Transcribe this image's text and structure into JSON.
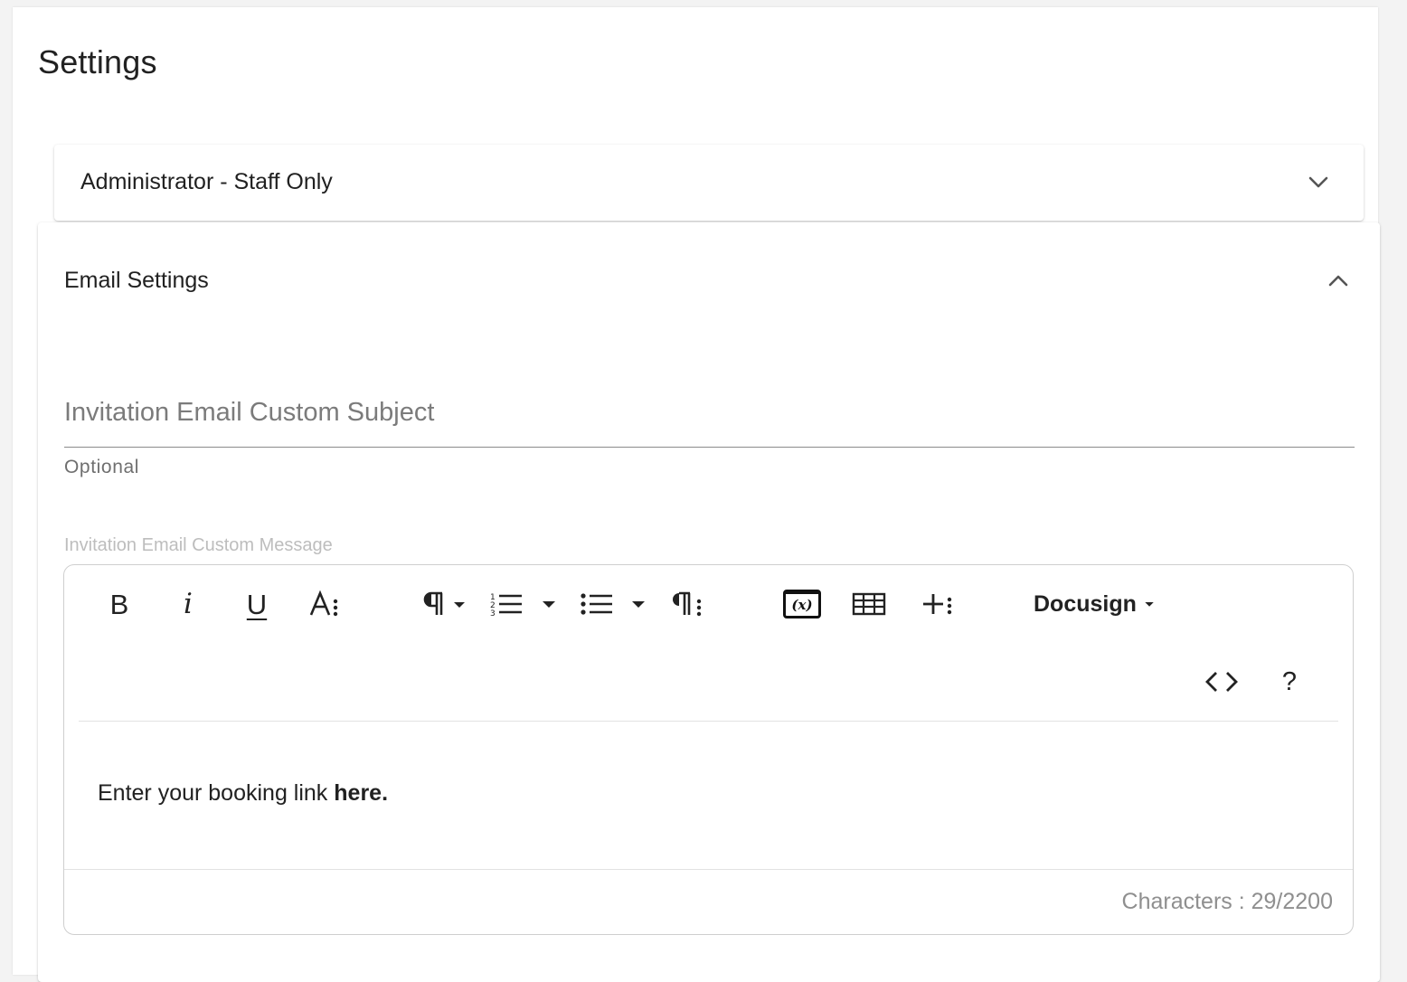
{
  "page": {
    "title": "Settings"
  },
  "panels": {
    "admin": {
      "title": "Administrator - Staff Only",
      "state": "collapsed"
    },
    "email": {
      "title": "Email Settings",
      "state": "expanded"
    }
  },
  "email_form": {
    "subject": {
      "placeholder": "Invitation Email Custom Subject",
      "value": "",
      "helper": "Optional"
    },
    "message": {
      "label": "Invitation Email Custom Message",
      "content_prefix": "Enter your booking link ",
      "content_bold": "here.",
      "char_count": "Characters : 29/2200"
    }
  },
  "toolbar": {
    "buttons": [
      {
        "name": "bold",
        "icon": "bold-icon"
      },
      {
        "name": "italic",
        "icon": "italic-icon"
      },
      {
        "name": "underline",
        "icon": "underline-icon"
      },
      {
        "name": "font-options",
        "icon": "text-style-icon"
      },
      {
        "name": "paragraph-format",
        "icon": "paragraph-icon"
      },
      {
        "name": "ordered-list",
        "icon": "ordered-list-icon"
      },
      {
        "name": "unordered-list",
        "icon": "unordered-list-icon"
      },
      {
        "name": "paragraph-options",
        "icon": "paragraph-options-icon"
      },
      {
        "name": "insert-variable",
        "icon": "variable-icon"
      },
      {
        "name": "insert-table",
        "icon": "table-icon"
      },
      {
        "name": "more-insert",
        "icon": "plus-more-icon"
      },
      {
        "name": "code-view",
        "icon": "code-icon"
      },
      {
        "name": "help",
        "icon": "help-icon"
      }
    ],
    "docusign_label": "Docusign",
    "bold_glyph": "B",
    "italic_glyph": "i",
    "underline_glyph": "U",
    "variable_glyph": "(x)",
    "help_glyph": "?"
  },
  "colors": {
    "page_bg": "#f3f3f3",
    "card_bg": "#ffffff",
    "text_primary": "#212121",
    "text_secondary": "#6f6f6f",
    "label_muted": "#bdbdbd",
    "char_count": "#8f8f8f"
  }
}
